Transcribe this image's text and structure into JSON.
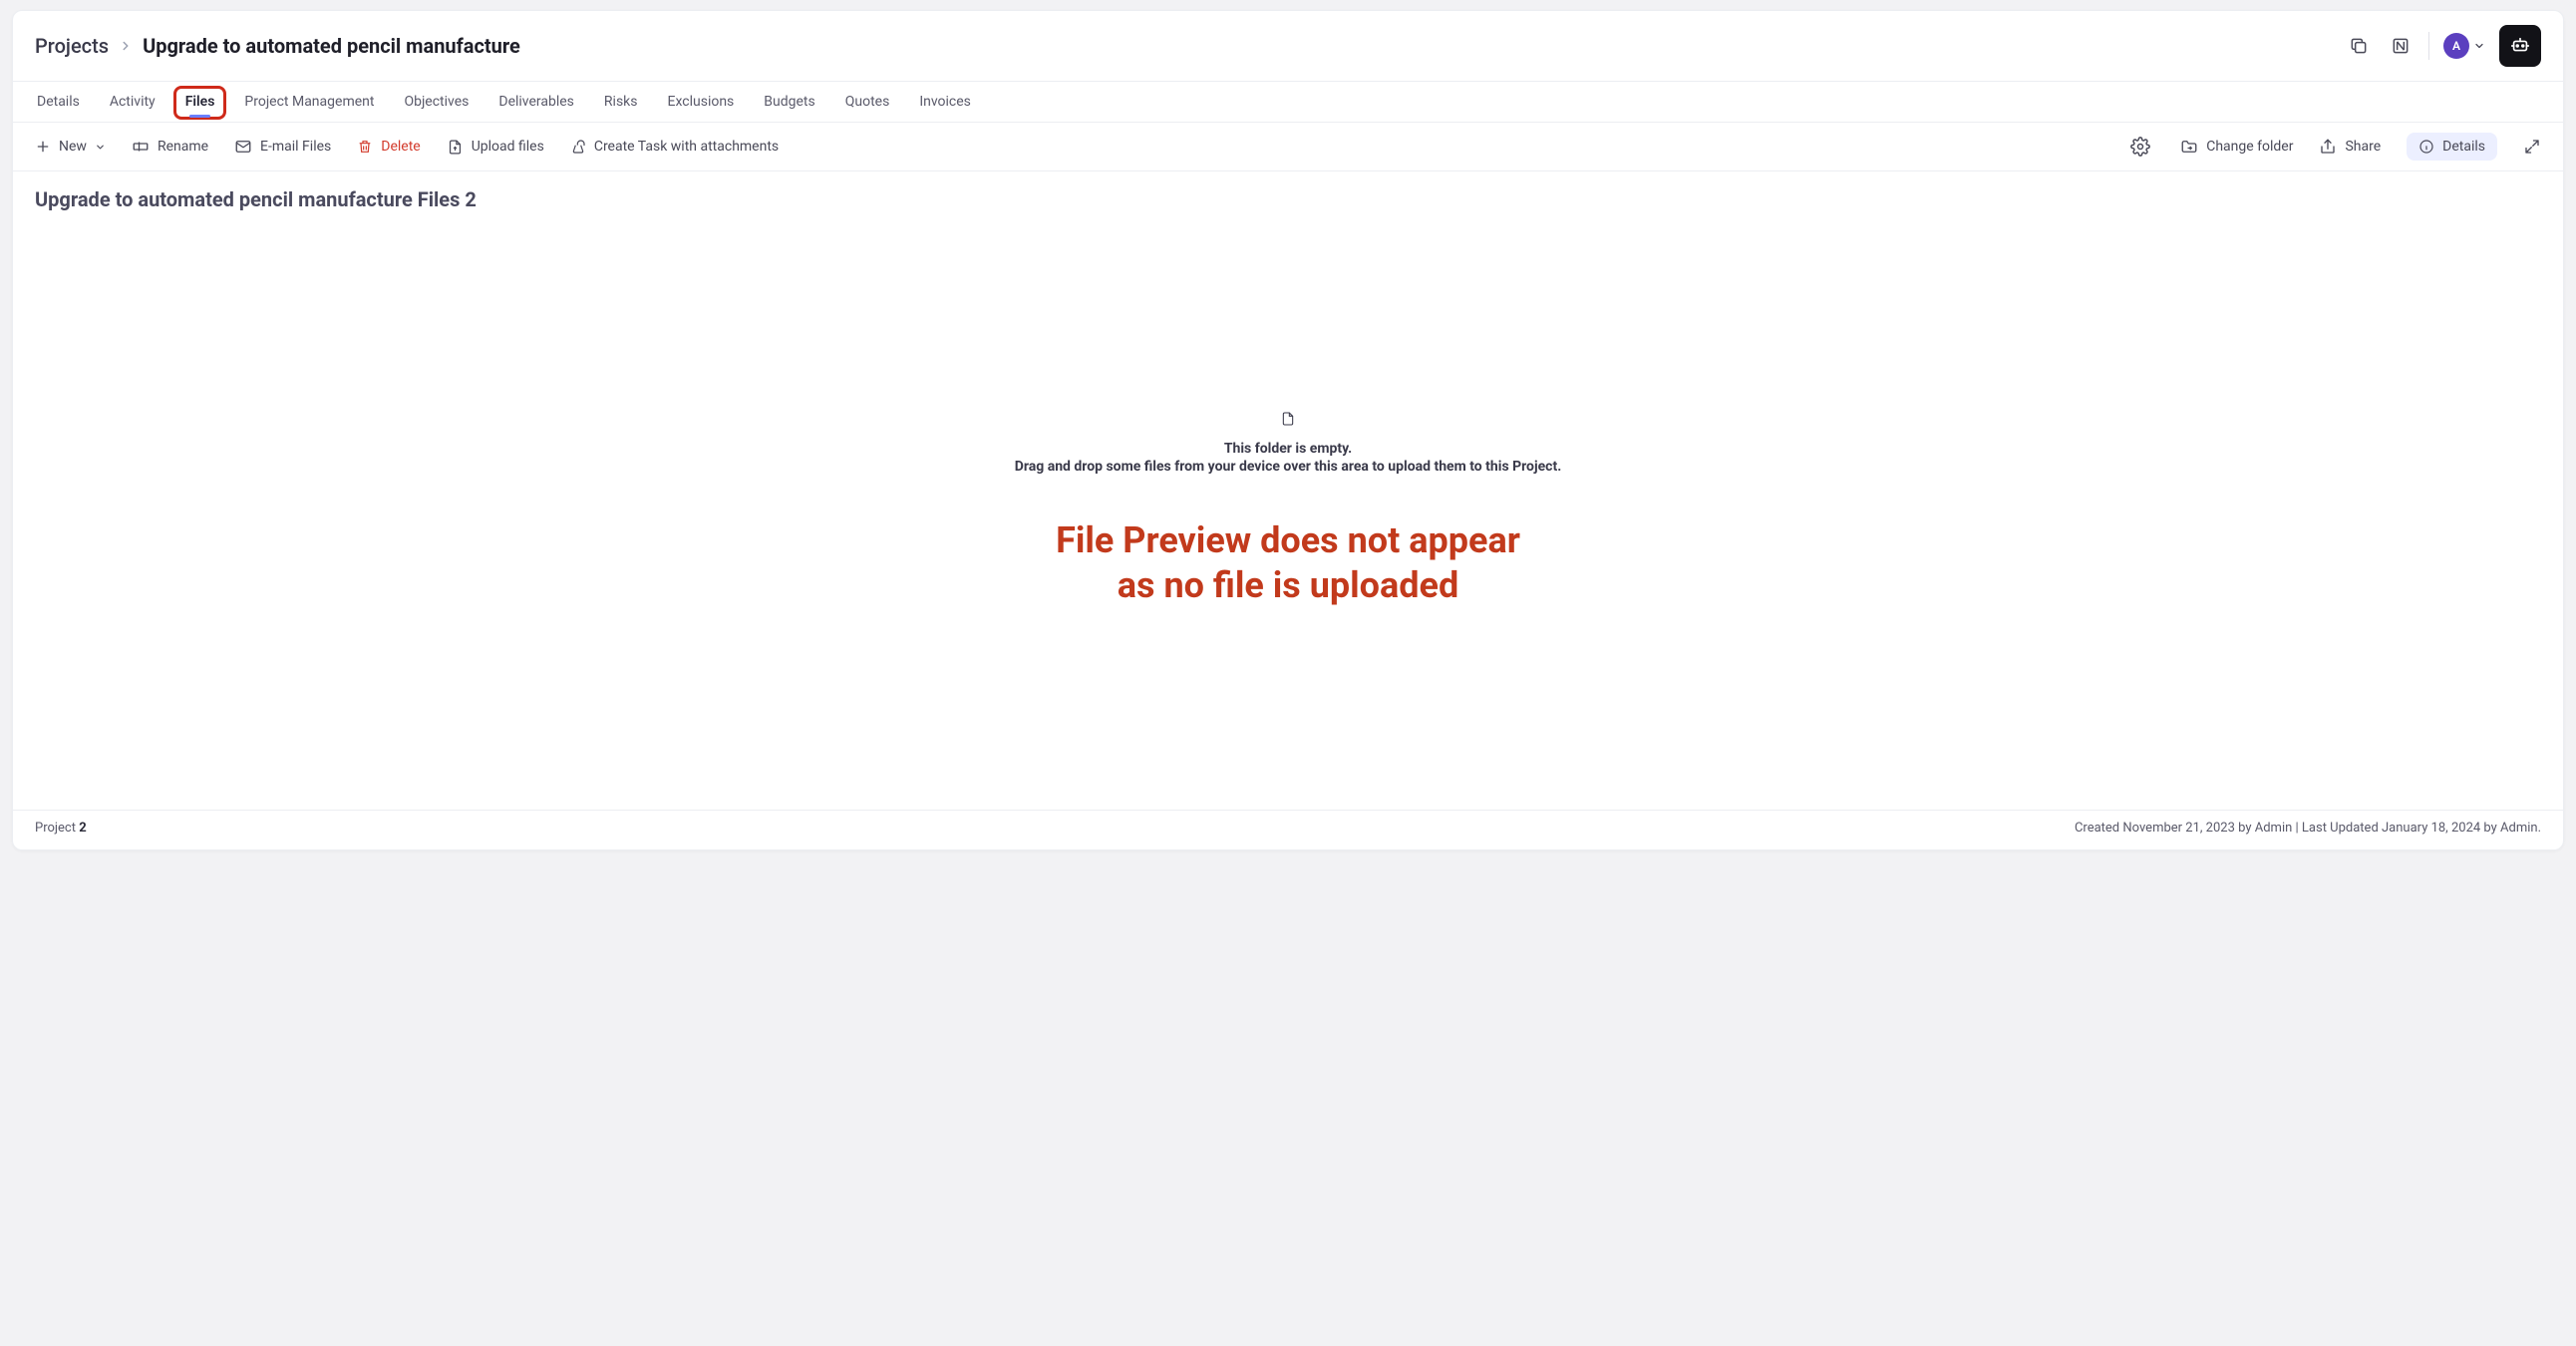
{
  "breadcrumb": {
    "root": "Projects",
    "title": "Upgrade to automated pencil manufacture"
  },
  "avatar": {
    "initial": "A"
  },
  "tabs": [
    {
      "label": "Details"
    },
    {
      "label": "Activity"
    },
    {
      "label": "Files",
      "active": true,
      "highlighted": true
    },
    {
      "label": "Project Management"
    },
    {
      "label": "Objectives"
    },
    {
      "label": "Deliverables"
    },
    {
      "label": "Risks"
    },
    {
      "label": "Exclusions"
    },
    {
      "label": "Budgets"
    },
    {
      "label": "Quotes"
    },
    {
      "label": "Invoices"
    }
  ],
  "toolbar": {
    "new": "New",
    "rename": "Rename",
    "email": "E-mail Files",
    "delete": "Delete",
    "upload": "Upload files",
    "createTask": "Create Task with attachments",
    "changeFolder": "Change folder",
    "share": "Share",
    "details": "Details"
  },
  "pageTitle": "Upgrade to automated pencil manufacture Files 2",
  "empty": {
    "line1": "This folder is empty.",
    "line2": "Drag and drop some files from your device over this area to upload them to this Project."
  },
  "annotation": {
    "line1": "File Preview does not appear",
    "line2": "as no file is uploaded"
  },
  "footer": {
    "projectLabel": "Project ",
    "projectNum": "2",
    "meta": "Created November 21, 2023 by Admin | Last Updated January 18, 2024 by Admin."
  }
}
